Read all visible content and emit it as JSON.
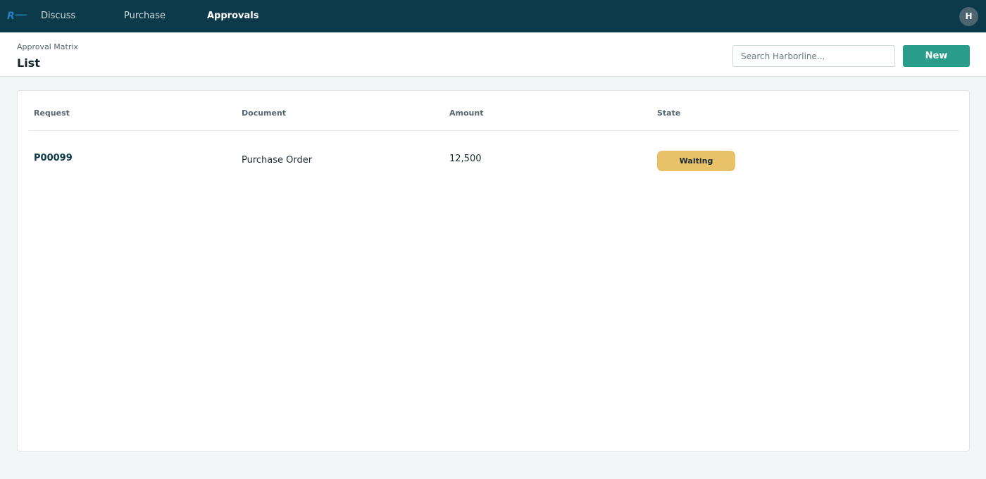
{
  "nav": {
    "items": [
      {
        "label": "Discuss",
        "active": false
      },
      {
        "label": "Purchase",
        "active": false
      },
      {
        "label": "Approvals",
        "active": true
      }
    ],
    "avatar_initial": "H"
  },
  "header": {
    "breadcrumb": "Approval Matrix",
    "title": "List",
    "search_placeholder": "Search Harborline...",
    "new_label": "New"
  },
  "table": {
    "columns": [
      "Request",
      "Document",
      "Amount",
      "State"
    ],
    "rows": [
      {
        "request": "P00099",
        "document": "Purchase Order",
        "amount": "12,500",
        "state": "Waiting"
      }
    ]
  },
  "colors": {
    "topbar": "#0d3a4a",
    "primary": "#2a9d8a",
    "state_waiting": "#e8c168"
  }
}
